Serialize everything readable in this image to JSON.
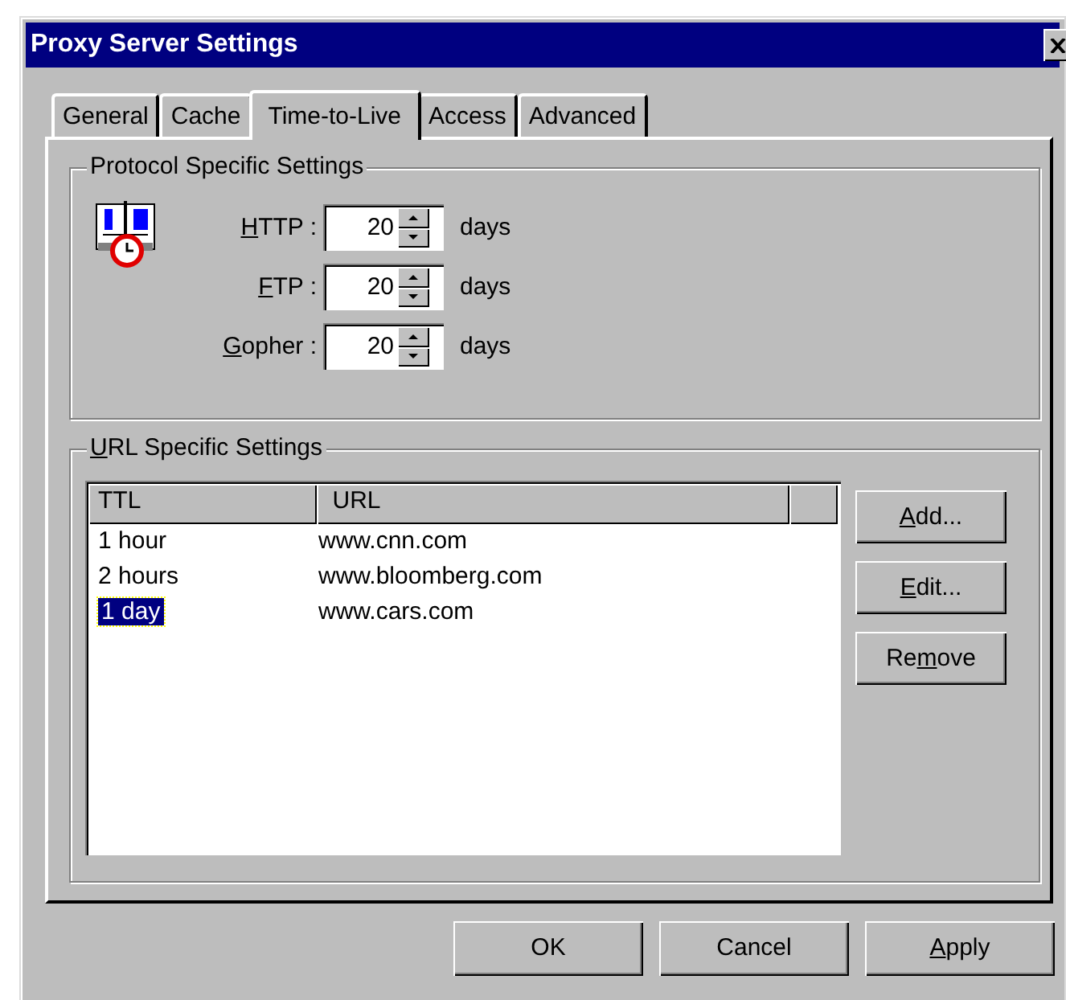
{
  "window": {
    "title": "Proxy Server Settings"
  },
  "tabs": [
    {
      "label": "General",
      "selected": false
    },
    {
      "label": "Cache",
      "selected": false
    },
    {
      "label": "Time-to-Live",
      "selected": true
    },
    {
      "label": "Access",
      "selected": false
    },
    {
      "label": "Advanced",
      "selected": false
    }
  ],
  "protocol_group": {
    "title": "Protocol Specific Settings",
    "rows": [
      {
        "label": [
          {
            "text": "H",
            "underline": true
          },
          {
            "text": "TTP :",
            "underline": false
          }
        ],
        "value": "20",
        "unit": "days"
      },
      {
        "label": [
          {
            "text": "F",
            "underline": true
          },
          {
            "text": "TP :",
            "underline": false
          }
        ],
        "value": "20",
        "unit": "days"
      },
      {
        "label": [
          {
            "text": "G",
            "underline": true
          },
          {
            "text": "opher :",
            "underline": false
          }
        ],
        "value": "20",
        "unit": "days"
      }
    ]
  },
  "url_group": {
    "title": [
      {
        "text": "U",
        "underline": true
      },
      {
        "text": "RL Specific Settings",
        "underline": false
      }
    ],
    "columns": [
      "TTL",
      "URL"
    ],
    "rows": [
      {
        "ttl": "1 hour",
        "url": "www.cnn.com",
        "selected": false
      },
      {
        "ttl": "2 hours",
        "url": "www.bloomberg.com",
        "selected": false
      },
      {
        "ttl": "1 day",
        "url": "www.cars.com",
        "selected": true
      }
    ],
    "buttons": [
      [
        {
          "text": "A",
          "underline": true
        },
        {
          "text": "dd...",
          "underline": false
        }
      ],
      [
        {
          "text": "E",
          "underline": true
        },
        {
          "text": "dit...",
          "underline": false
        }
      ],
      [
        {
          "text": "Re",
          "underline": false
        },
        {
          "text": "m",
          "underline": true
        },
        {
          "text": "ove",
          "underline": false
        }
      ]
    ]
  },
  "buttons": [
    [
      {
        "text": "OK",
        "underline": false
      }
    ],
    [
      {
        "text": "Cancel",
        "underline": false
      }
    ],
    [
      {
        "text": "A",
        "underline": true
      },
      {
        "text": "pply",
        "underline": false
      }
    ]
  ]
}
